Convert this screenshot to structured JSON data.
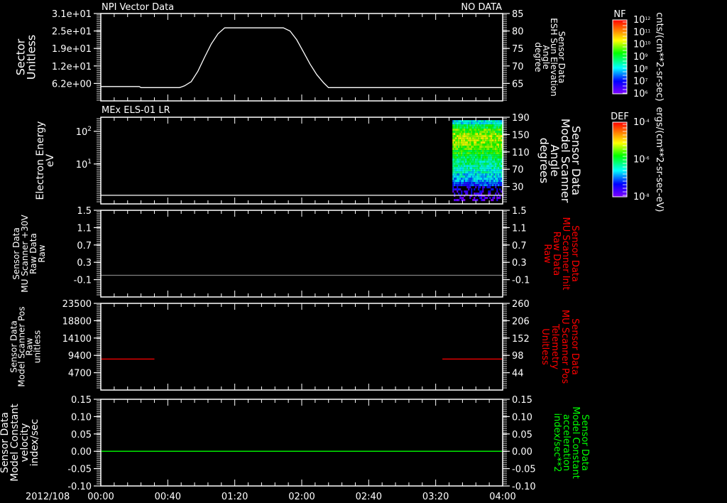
{
  "colors": {
    "background": "#000000",
    "axes": "#ffffff",
    "red": "#ff0000",
    "green": "#00ff00",
    "grey_trace": "#808080"
  },
  "date_label": "2012/108",
  "time_axis": {
    "range_min": [
      0,
      240
    ],
    "ticks": [
      {
        "min": 0,
        "label": "00:00"
      },
      {
        "min": 40,
        "label": "00:40"
      },
      {
        "min": 80,
        "label": "01:20"
      },
      {
        "min": 120,
        "label": "02:00"
      },
      {
        "min": 160,
        "label": "02:40"
      },
      {
        "min": 200,
        "label": "03:20"
      },
      {
        "min": 240,
        "label": "04:00"
      }
    ]
  },
  "chart_data": [
    {
      "type": "line",
      "title": "NPI Vector Data",
      "status": "NO DATA",
      "left_axis": {
        "label": [
          "Sector",
          "Unitless"
        ],
        "color": "#ffffff",
        "range": [
          0,
          31
        ],
        "ticks": [
          {
            "v": 31,
            "label": "3.1e+01"
          },
          {
            "v": 24.8,
            "label": "2.5e+01"
          },
          {
            "v": 18.6,
            "label": "1.9e+01"
          },
          {
            "v": 12.4,
            "label": "1.2e+01"
          },
          {
            "v": 6.2,
            "label": "6.2e+00"
          }
        ]
      },
      "right_axis": {
        "label": [
          "Sensor Data",
          "ESH Sun Elevation",
          "Angle",
          "degree"
        ],
        "color": "#ffffff",
        "range": [
          60,
          85
        ],
        "ticks": [
          {
            "v": 85,
            "label": "85"
          },
          {
            "v": 80,
            "label": "80"
          },
          {
            "v": 75,
            "label": "75"
          },
          {
            "v": 70,
            "label": "70"
          },
          {
            "v": 65,
            "label": "65"
          }
        ]
      },
      "series": [
        {
          "axis": "right",
          "color": "#ffffff",
          "x": [
            0,
            23,
            24,
            47,
            50,
            54,
            58,
            62,
            66,
            70,
            74,
            109,
            113,
            117,
            121,
            125,
            129,
            133,
            136,
            240
          ],
          "y": [
            64.1,
            64.1,
            63.8,
            63.8,
            64.3,
            65.5,
            68.5,
            72.5,
            76.3,
            79.2,
            80.9,
            80.9,
            80.0,
            77.5,
            74.0,
            70.5,
            67.5,
            65.2,
            63.8,
            63.8
          ]
        }
      ]
    },
    {
      "type": "heatmap",
      "title": "MEx ELS-01 LR",
      "left_axis": {
        "label": [
          "Electron Energy",
          "eV"
        ],
        "color": "#ffffff",
        "log": true,
        "range": [
          0.6,
          270
        ],
        "ticks": [
          {
            "v": 100,
            "label": "10",
            "sup": "2"
          },
          {
            "v": 10,
            "label": "10",
            "sup": "1"
          }
        ]
      },
      "right_axis": {
        "label": [
          "Sensor Data",
          "Model Scanner",
          "Angle",
          "degrees"
        ],
        "color": "#ffffff",
        "range": [
          -10,
          190
        ],
        "ticks": [
          {
            "v": 190,
            "label": "190"
          },
          {
            "v": 150,
            "label": "150"
          },
          {
            "v": 110,
            "label": "110"
          },
          {
            "v": 70,
            "label": "70"
          },
          {
            "v": 30,
            "label": "30"
          }
        ]
      },
      "series": [
        {
          "axis": "left",
          "color": "#ffffff",
          "x": [
            0,
            240
          ],
          "y": [
            1.1,
            1.1
          ]
        }
      ],
      "spectrogram": {
        "x_range_min": [
          210,
          240
        ],
        "energy_range": [
          0.75,
          220
        ],
        "level_profile_top_to_bottom": [
          0.35,
          0.5,
          0.58,
          0.64,
          0.66,
          0.64,
          0.6,
          0.55,
          0.5,
          0.46,
          0.44,
          0.42,
          0.38,
          0.34,
          0.3,
          0.2,
          0.12,
          0.1,
          0.08,
          0.06
        ]
      }
    },
    {
      "type": "line",
      "left_axis": {
        "label": [
          "Sensor Data",
          "MU Scanner +30V",
          "Raw Data",
          "Raw"
        ],
        "color": "#ffffff",
        "range": [
          -0.5,
          1.5
        ],
        "ticks": [
          {
            "v": 1.5,
            "label": "1.5"
          },
          {
            "v": 1.1,
            "label": "1.1"
          },
          {
            "v": 0.7,
            "label": "0.7"
          },
          {
            "v": 0.3,
            "label": "0.3"
          },
          {
            "v": -0.1,
            "label": "-0.1"
          }
        ]
      },
      "right_axis": {
        "label": [
          "Sensor Data",
          "MU Scanner Init",
          "Raw Data",
          "Raw"
        ],
        "color": "#ff0000",
        "range": [
          -0.5,
          1.5
        ],
        "ticks": [
          {
            "v": 1.5,
            "label": "1.5"
          },
          {
            "v": 1.1,
            "label": "1.1"
          },
          {
            "v": 0.7,
            "label": "0.7"
          },
          {
            "v": 0.3,
            "label": "0.3"
          },
          {
            "v": -0.1,
            "label": "-0.1"
          }
        ]
      },
      "series": [
        {
          "axis": "left",
          "color": "#808080",
          "x": [
            0,
            240
          ],
          "y": [
            0.0,
            0.0
          ]
        }
      ]
    },
    {
      "type": "line",
      "left_axis": {
        "label": [
          "Sensor Data",
          "Model Scanner Pos",
          "Raw",
          "unitless"
        ],
        "color": "#ffffff",
        "range": [
          0,
          23500
        ],
        "ticks": [
          {
            "v": 23500,
            "label": "23500"
          },
          {
            "v": 18800,
            "label": "18800"
          },
          {
            "v": 14100,
            "label": "14100"
          },
          {
            "v": 9400,
            "label": "9400"
          },
          {
            "v": 4700,
            "label": "4700"
          }
        ]
      },
      "right_axis": {
        "label": [
          "Sensor Data",
          "MU Scanner Pos",
          "Telemetry",
          "Unitless"
        ],
        "color": "#ff0000",
        "range": [
          -10,
          260
        ],
        "ticks": [
          {
            "v": 260,
            "label": "260"
          },
          {
            "v": 206,
            "label": "206"
          },
          {
            "v": 152,
            "label": "152"
          },
          {
            "v": 98,
            "label": "98"
          },
          {
            "v": 44,
            "label": "44"
          }
        ]
      },
      "series": [
        {
          "axis": "left",
          "color": "#ff0000",
          "x": [
            0,
            32
          ],
          "y": [
            8400,
            8400
          ]
        },
        {
          "axis": "left",
          "color": "#ff0000",
          "x": [
            204,
            240
          ],
          "y": [
            8400,
            8400
          ]
        }
      ]
    },
    {
      "type": "line",
      "left_axis": {
        "label": [
          "Sensor Data",
          "Model Constant",
          "velocity",
          "index/sec"
        ],
        "color": "#ffffff",
        "range": [
          -0.1,
          0.15
        ],
        "ticks": [
          {
            "v": 0.15,
            "label": "0.15"
          },
          {
            "v": 0.1,
            "label": "0.10"
          },
          {
            "v": 0.05,
            "label": "0.05"
          },
          {
            "v": 0.0,
            "label": "0.00"
          },
          {
            "v": -0.05,
            "label": "-0.05"
          },
          {
            "v": -0.1,
            "label": "-0.10"
          }
        ]
      },
      "right_axis": {
        "label": [
          "Sensor Data",
          "Model Constant",
          "acceleration",
          "index/sec**2"
        ],
        "color": "#00ff00",
        "range": [
          -0.1,
          0.15
        ],
        "ticks": [
          {
            "v": 0.15,
            "label": "0.15"
          },
          {
            "v": 0.1,
            "label": "0.10"
          },
          {
            "v": 0.05,
            "label": "0.05"
          },
          {
            "v": 0.0,
            "label": "0.00"
          },
          {
            "v": -0.05,
            "label": "-0.05"
          },
          {
            "v": -0.1,
            "label": "-0.10"
          }
        ]
      },
      "series": [
        {
          "axis": "left",
          "color": "#00ff00",
          "x": [
            0,
            240
          ],
          "y": [
            0,
            0
          ]
        }
      ]
    }
  ],
  "colorbars": [
    {
      "title": "NF",
      "units": "cnts/(cm**2-sr-sec)",
      "ticks": [
        {
          "b": "10",
          "e": "12"
        },
        {
          "b": "10",
          "e": "11"
        },
        {
          "b": "10",
          "e": "10"
        },
        {
          "b": "10",
          "e": "9"
        },
        {
          "b": "10",
          "e": "8"
        },
        {
          "b": "10",
          "e": "7"
        },
        {
          "b": "10",
          "e": "6"
        }
      ]
    },
    {
      "title": "DEF",
      "units": "ergs/(cm**2-sr-sec-eV)",
      "ticks": [
        {
          "b": "10",
          "e": "-4"
        },
        {
          "b": "10",
          "e": "-6"
        },
        {
          "b": "10",
          "e": "-8"
        }
      ]
    }
  ]
}
